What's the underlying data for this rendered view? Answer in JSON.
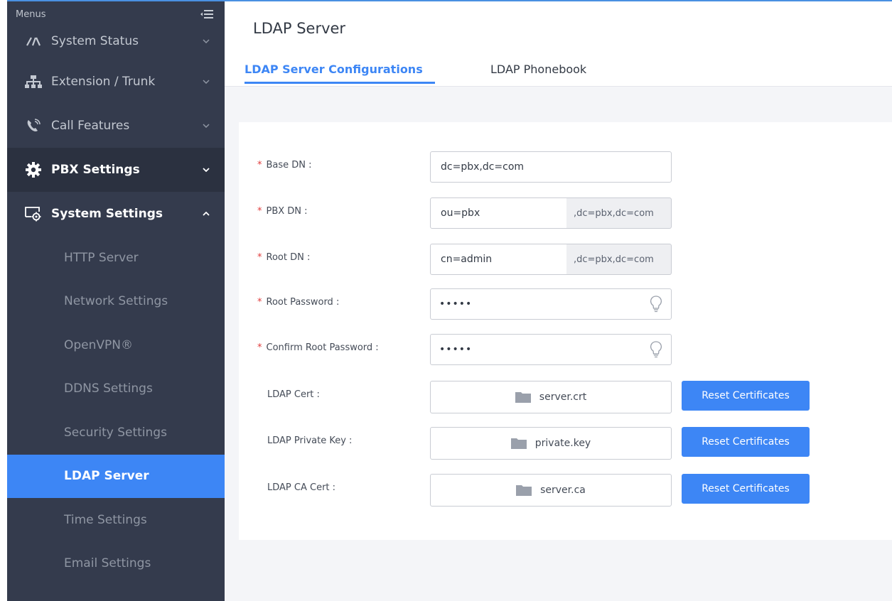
{
  "sidebar": {
    "menus_label": "Menus",
    "items": [
      {
        "label": "System Status",
        "icon": "gauge-icon"
      },
      {
        "label": "Extension / Trunk",
        "icon": "network-icon"
      },
      {
        "label": "Call Features",
        "icon": "phone-icon"
      },
      {
        "label": "PBX Settings",
        "icon": "gear-icon"
      },
      {
        "label": "System Settings",
        "icon": "system-settings-icon"
      }
    ],
    "sub_items": [
      {
        "label": "HTTP Server"
      },
      {
        "label": "Network Settings"
      },
      {
        "label": "OpenVPN®"
      },
      {
        "label": "DDNS Settings"
      },
      {
        "label": "Security Settings"
      },
      {
        "label": "LDAP Server"
      },
      {
        "label": "Time Settings"
      },
      {
        "label": "Email Settings"
      }
    ]
  },
  "header": {
    "title": "LDAP Server",
    "tabs": [
      {
        "label": "LDAP Server Configurations"
      },
      {
        "label": "LDAP Phonebook"
      }
    ]
  },
  "form": {
    "base_dn": {
      "label": "Base DN :",
      "value": "dc=pbx,dc=com"
    },
    "pbx_dn": {
      "label": "PBX DN :",
      "value": "ou=pbx",
      "suffix": ",dc=pbx,dc=com"
    },
    "root_dn": {
      "label": "Root DN :",
      "value": "cn=admin",
      "suffix": ",dc=pbx,dc=com"
    },
    "root_password": {
      "label": "Root Password :",
      "value": "•••••"
    },
    "confirm_password": {
      "label": "Confirm Root Password :",
      "value": "•••••"
    },
    "ldap_cert": {
      "label": "LDAP Cert :",
      "file": "server.crt",
      "button": "Reset Certificates"
    },
    "ldap_private_key": {
      "label": "LDAP Private Key :",
      "file": "private.key",
      "button": "Reset Certificates"
    },
    "ldap_ca_cert": {
      "label": "LDAP CA Cert :",
      "file": "server.ca",
      "button": "Reset Certificates"
    }
  },
  "colors": {
    "sidebar_bg": "#343b4d",
    "accent": "#3d86f5",
    "required_star": "#e03b3b"
  }
}
